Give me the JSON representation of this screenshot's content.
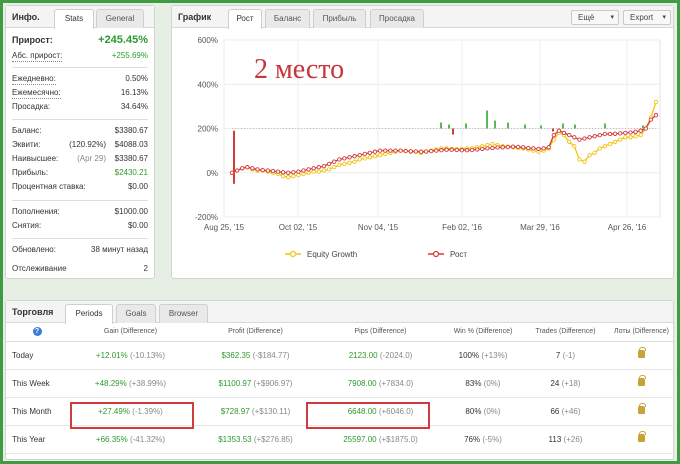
{
  "stats": {
    "title": "Инфо.",
    "tabs": [
      "Stats",
      "General"
    ],
    "rows": [
      {
        "label": "Прирост:",
        "value": "+245.45%"
      },
      {
        "label": "Абс. прирост:",
        "value": "+255.69%"
      },
      {
        "label": "Ежедневно:",
        "value": "0.50%"
      },
      {
        "label": "Ежемесячно:",
        "value": "16.13%"
      },
      {
        "label": "Просадка:",
        "value": "34.64%"
      },
      {
        "label": "Баланс:",
        "value": "$3380.67"
      },
      {
        "label": "Эквити:",
        "extra": "(120.92%)",
        "value": "$4088.03"
      },
      {
        "label": "Наивысшее:",
        "extra": "(Apr 29)",
        "value": "$3380.67"
      },
      {
        "label": "Прибыль:",
        "value": "$2430.21"
      },
      {
        "label": "Процентная ставка:",
        "value": "$0.00"
      },
      {
        "label": "Пополнения:",
        "value": "$1000.00"
      },
      {
        "label": "Снятия:",
        "value": "$0.00"
      },
      {
        "label": "Обновлено:",
        "value": "38 минут назад"
      },
      {
        "label": "Отслеживание",
        "value": "2"
      }
    ]
  },
  "chart": {
    "title": "График",
    "tabs": [
      "Рост",
      "Баланс",
      "Прибыль",
      "Просадка"
    ],
    "menu1": "Ещё",
    "menu2": "Export",
    "annotation": "2 место",
    "colors": {
      "equity": "#f2c40f",
      "growth": "#d23b3b",
      "bars_pos": "#59b85a",
      "bars_neg": "#d23b3b"
    }
  },
  "chart_data": {
    "type": "line",
    "ylim": [
      -200,
      600
    ],
    "y_ticks": [
      "600%",
      "400%",
      "200%",
      "0%",
      "-200%"
    ],
    "x_ticks": [
      "Aug 25, '15",
      "Oct 02, '15",
      "Nov 04, '15",
      "Feb 02, '16",
      "Mar 29, '16",
      "Apr 26, '16"
    ],
    "legend": [
      "Equity Growth",
      "Рост"
    ],
    "series": [
      {
        "name": "Equity Growth",
        "values": [
          0,
          10,
          20,
          25,
          15,
          10,
          10,
          5,
          0,
          -5,
          -15,
          -20,
          -15,
          -10,
          -5,
          0,
          5,
          5,
          10,
          15,
          25,
          35,
          40,
          45,
          50,
          60,
          65,
          70,
          75,
          80,
          85,
          90,
          95,
          100,
          100,
          95,
          95,
          90,
          95,
          100,
          105,
          110,
          110,
          108,
          106,
          108,
          110,
          112,
          115,
          120,
          125,
          130,
          125,
          120,
          118,
          115,
          112,
          110,
          105,
          100,
          95,
          100,
          110,
          150,
          180,
          170,
          140,
          120,
          60,
          50,
          80,
          90,
          110,
          120,
          130,
          140,
          150,
          160,
          160,
          165,
          170,
          200,
          250,
          320
        ]
      },
      {
        "name": "Рост",
        "values": [
          0,
          10,
          20,
          25,
          20,
          15,
          12,
          10,
          8,
          5,
          2,
          0,
          2,
          5,
          10,
          15,
          20,
          25,
          30,
          40,
          50,
          60,
          65,
          70,
          75,
          80,
          85,
          90,
          95,
          100,
          100,
          100,
          100,
          100,
          98,
          97,
          96,
          95,
          96,
          98,
          100,
          102,
          104,
          104,
          103,
          102,
          102,
          103,
          105,
          108,
          110,
          112,
          114,
          115,
          116,
          118,
          117,
          115,
          112,
          110,
          108,
          110,
          115,
          170,
          190,
          180,
          170,
          160,
          150,
          155,
          160,
          165,
          170,
          175,
          175,
          176,
          178,
          180,
          182,
          185,
          190,
          200,
          240,
          260
        ]
      }
    ],
    "bars_note": "daily gain/loss bars around 200% baseline"
  },
  "trading": {
    "title": "Торговля",
    "tabs": [
      "Periods",
      "Goals",
      "Browser"
    ],
    "headers": [
      "Gain (Difference)",
      "Profit (Difference)",
      "Pips (Difference)",
      "Win % (Difference)",
      "Trades (Difference)",
      "Лоты (Difference)"
    ],
    "rows": [
      {
        "label": "Today",
        "gain": "+12.01%",
        "gain_d": "(-10.13%)",
        "profit": "$362.35",
        "profit_d": "(-$184.77)",
        "pips": "2123.00",
        "pips_d": "(-2024.0)",
        "win": "100%",
        "win_d": "(+13%)",
        "trades": "7",
        "trades_d": "(-1)"
      },
      {
        "label": "This Week",
        "gain": "+48.29%",
        "gain_d": "(+38.99%)",
        "profit": "$1100.97",
        "profit_d": "(+$906.97)",
        "pips": "7908.00",
        "pips_d": "(+7834.0)",
        "win": "83%",
        "win_d": "(0%)",
        "trades": "24",
        "trades_d": "(+18)"
      },
      {
        "label": "This Month",
        "gain": "+27.49%",
        "gain_d": "(-1.39%)",
        "profit": "$728.97",
        "profit_d": "(+$130.11)",
        "pips": "6648.00",
        "pips_d": "(+6046.0)",
        "win": "80%",
        "win_d": "(0%)",
        "trades": "66",
        "trades_d": "(+46)"
      },
      {
        "label": "This Year",
        "gain": "+66.35%",
        "gain_d": "(-41.32%)",
        "profit": "$1353.53",
        "profit_d": "(+$276.85)",
        "pips": "25597.00",
        "pips_d": "(+$1875.0)",
        "win": "76%",
        "win_d": "(-5%)",
        "trades": "113",
        "trades_d": "(+26)"
      }
    ]
  }
}
